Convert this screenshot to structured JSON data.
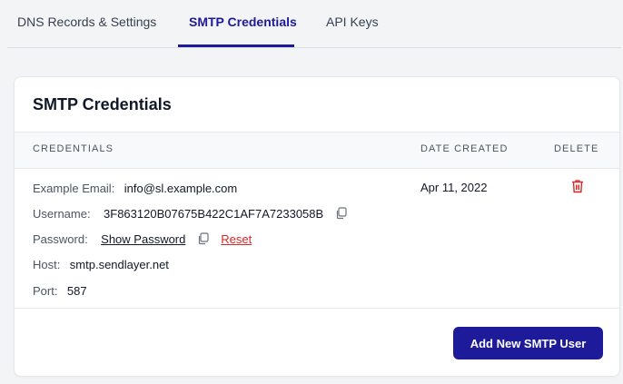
{
  "tabs": [
    {
      "label": "DNS Records & Settings"
    },
    {
      "label": "SMTP Credentials"
    },
    {
      "label": "API Keys"
    }
  ],
  "card": {
    "title": "SMTP Credentials",
    "columns": {
      "credentials": "CREDENTIALS",
      "date_created": "DATE CREATED",
      "delete": "DELETE"
    },
    "row": {
      "example_email_label": "Example Email:",
      "example_email_value": "info@sl.example.com",
      "username_label": "Username:",
      "username_value": "3F863120B07675B422C1AF7A7233058B",
      "password_label": "Password:",
      "show_password": "Show Password",
      "reset": "Reset",
      "host_label": "Host:",
      "host_value": "smtp.sendlayer.net",
      "port_label": "Port:",
      "port_value": "587",
      "date_created": "Apr 11, 2022"
    },
    "add_button": "Add New SMTP User"
  },
  "colors": {
    "accent": "#1e1b9a",
    "danger": "#dc2626"
  }
}
